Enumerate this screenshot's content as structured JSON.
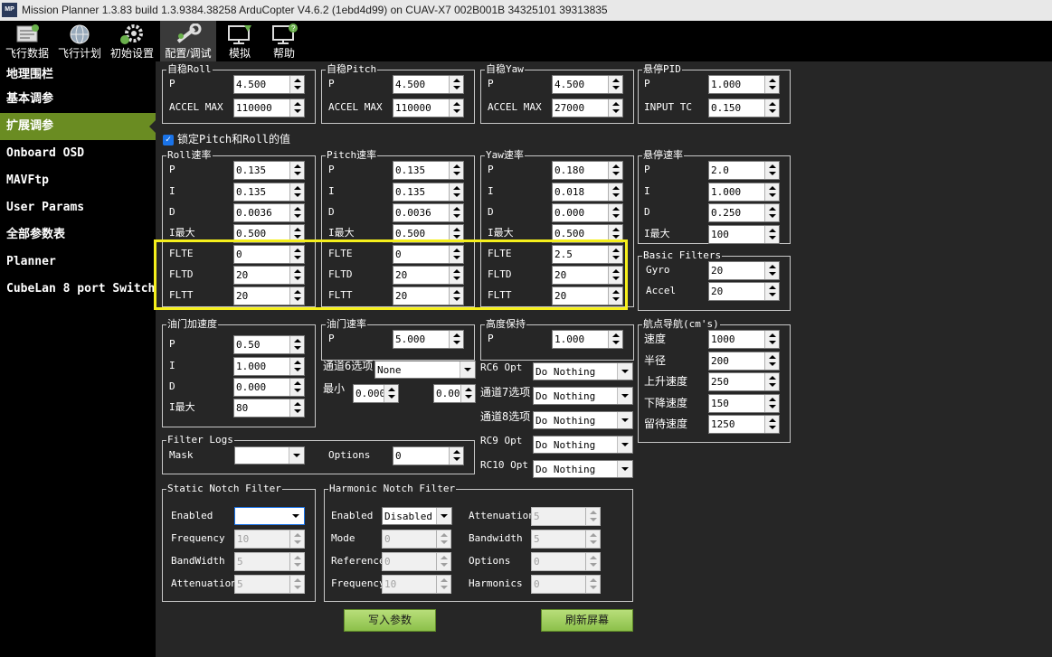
{
  "window": {
    "title": "Mission Planner 1.3.83 build 1.3.9384.38258 ArduCopter V4.6.2 (1ebd4d99) on CUAV-X7 002B001B 34325101 39313835",
    "logo": "MP"
  },
  "toolbar": [
    {
      "label": "飞行数据",
      "icon": "flight-data-icon"
    },
    {
      "label": "飞行计划",
      "icon": "globe-icon"
    },
    {
      "label": "初始设置",
      "icon": "gear-icon"
    },
    {
      "label": "配置/调试",
      "icon": "wrench-icon"
    },
    {
      "label": "模拟",
      "icon": "simulation-icon"
    },
    {
      "label": "帮助",
      "icon": "help-icon"
    }
  ],
  "sidebar": [
    "地理围栏",
    "基本调参",
    "扩展调参",
    "Onboard OSD",
    "MAVFtp",
    "User Params",
    "全部参数表",
    "Planner",
    "CubeLan 8 port Switch"
  ],
  "stab": [
    {
      "title": "自稳Roll",
      "p": "4.500",
      "accel": "110000"
    },
    {
      "title": "自稳Pitch",
      "p": "4.500",
      "accel": "110000"
    },
    {
      "title": "自稳Yaw",
      "p": "4.500",
      "accel": "27000"
    }
  ],
  "labels": {
    "p": "P",
    "i": "I",
    "d": "D",
    "imax": "I最大",
    "accel_max": "ACCEL MAX",
    "input_tc": "INPUT TC",
    "flte": "FLTE",
    "fltd": "FLTD",
    "fltt": "FLTT",
    "gyro": "Gyro",
    "accel": "Accel"
  },
  "loiter_pid": {
    "title": "悬停PID",
    "p": "1.000",
    "input_tc": "0.150"
  },
  "lock_pitch_roll": "锁定Pitch和Roll的值",
  "rate": [
    {
      "title": "Roll速率",
      "p": "0.135",
      "i": "0.135",
      "d": "0.0036",
      "imax": "0.500",
      "flte": "0",
      "fltd": "20",
      "fltt": "20"
    },
    {
      "title": "Pitch速率",
      "p": "0.135",
      "i": "0.135",
      "d": "0.0036",
      "imax": "0.500",
      "flte": "0",
      "fltd": "20",
      "fltt": "20"
    },
    {
      "title": "Yaw速率",
      "p": "0.180",
      "i": "0.018",
      "d": "0.000",
      "imax": "0.500",
      "flte": "2.5",
      "fltd": "20",
      "fltt": "20"
    }
  ],
  "loiter_rate": {
    "title": "悬停速率",
    "p": "2.0",
    "i": "1.000",
    "d": "0.250",
    "imax": "100"
  },
  "basic_filters": {
    "title": "Basic Filters",
    "gyro": "20",
    "accel": "20"
  },
  "throttle_accel": {
    "title": "油门加速度",
    "p": "0.50",
    "i": "1.000",
    "d": "0.000",
    "imax": "80"
  },
  "throttle_rate": {
    "title": "油门速率",
    "p": "5.000",
    "ch6_label": "通道6选项",
    "ch6_value": "None",
    "min_label": "最小",
    "min_value": "0.000",
    "max_value": "0.000"
  },
  "alt_hold": {
    "title": "高度保持",
    "p": "1.000"
  },
  "rc_options": [
    {
      "label": "RC6 Opt",
      "value": "Do Nothing"
    },
    {
      "label": "通道7选项",
      "value": "Do Nothing"
    },
    {
      "label": "通道8选项",
      "value": "Do Nothing"
    },
    {
      "label": "RC9 Opt",
      "value": "Do Nothing"
    },
    {
      "label": "RC10 Opt",
      "value": "Do Nothing"
    }
  ],
  "wpnav": {
    "title": "航点导航(cm's)",
    "speed_label": "速度",
    "speed": "1000",
    "radius_label": "半径",
    "radius": "200",
    "up_label": "上升速度",
    "up": "250",
    "down_label": "下降速度",
    "down": "150",
    "loiter_label": "留待速度",
    "loiter": "1250"
  },
  "filter_logs": {
    "title": "Filter Logs",
    "mask_label": "Mask",
    "mask_value": "",
    "options_label": "Options",
    "options_value": "0"
  },
  "static_notch": {
    "title": "Static Notch Filter",
    "enabled_label": "Enabled",
    "enabled": "",
    "frequency_label": "Frequency",
    "frequency": "10",
    "bandwidth_label": "BandWidth",
    "bandwidth": "5",
    "attenuation_label": "Attenuation",
    "attenuation": "5"
  },
  "harmonic_notch": {
    "title": "Harmonic Notch Filter",
    "enabled_label": "Enabled",
    "enabled": "Disabled",
    "mode_label": "Mode",
    "mode": "0",
    "reference_label": "Reference",
    "reference": "0",
    "frequency_label": "Frequency",
    "frequency": "10",
    "attenuation_label": "Attenuation",
    "attenuation": "5",
    "bandwidth_label": "Bandwidth",
    "bandwidth": "5",
    "options_label": "Options",
    "options": "0",
    "harmonics_label": "Harmonics",
    "harmonics": "0"
  },
  "buttons": {
    "write": "写入参数",
    "refresh": "刷新屏幕"
  },
  "colors": {
    "sidebar_active": "#6a8c22",
    "highlight": "#f5ef1c",
    "panel_bg": "#262626"
  }
}
